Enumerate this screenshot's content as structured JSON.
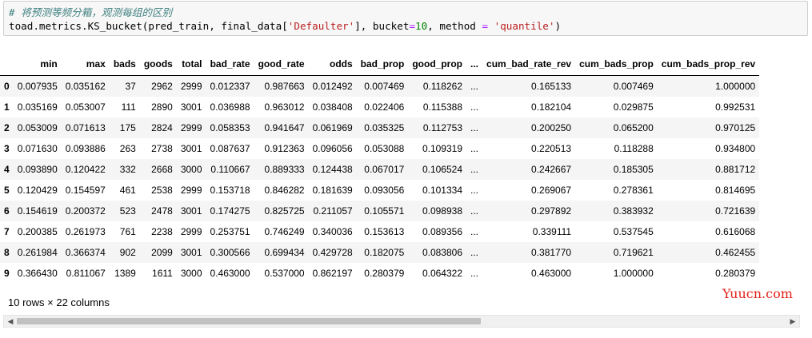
{
  "input": {
    "comment": "# 将预测等频分箱，观测每组的区别",
    "code_prefix": "toad.metrics.KS_bucket(pred_train, final_data[",
    "code_str1": "'Defaulter'",
    "code_mid": "], bucket",
    "code_eq1": "=",
    "code_num": "10",
    "code_mid2": ", method ",
    "code_eq2": "=",
    "code_str2": " 'quantile'",
    "code_suffix": ")"
  },
  "table": {
    "columns": [
      "",
      "min",
      "max",
      "bads",
      "goods",
      "total",
      "bad_rate",
      "good_rate",
      "odds",
      "bad_prop",
      "good_prop",
      "...",
      "cum_bad_rate_rev",
      "cum_bads_prop",
      "cum_bads_prop_rev"
    ],
    "rows": [
      [
        "0",
        "0.007935",
        "0.035162",
        "37",
        "2962",
        "2999",
        "0.012337",
        "0.987663",
        "0.012492",
        "0.007469",
        "0.118262",
        "...",
        "0.165133",
        "0.007469",
        "1.000000"
      ],
      [
        "1",
        "0.035169",
        "0.053007",
        "111",
        "2890",
        "3001",
        "0.036988",
        "0.963012",
        "0.038408",
        "0.022406",
        "0.115388",
        "...",
        "0.182104",
        "0.029875",
        "0.992531"
      ],
      [
        "2",
        "0.053009",
        "0.071613",
        "175",
        "2824",
        "2999",
        "0.058353",
        "0.941647",
        "0.061969",
        "0.035325",
        "0.112753",
        "...",
        "0.200250",
        "0.065200",
        "0.970125"
      ],
      [
        "3",
        "0.071630",
        "0.093886",
        "263",
        "2738",
        "3001",
        "0.087637",
        "0.912363",
        "0.096056",
        "0.053088",
        "0.109319",
        "...",
        "0.220513",
        "0.118288",
        "0.934800"
      ],
      [
        "4",
        "0.093890",
        "0.120422",
        "332",
        "2668",
        "3000",
        "0.110667",
        "0.889333",
        "0.124438",
        "0.067017",
        "0.106524",
        "...",
        "0.242667",
        "0.185305",
        "0.881712"
      ],
      [
        "5",
        "0.120429",
        "0.154597",
        "461",
        "2538",
        "2999",
        "0.153718",
        "0.846282",
        "0.181639",
        "0.093056",
        "0.101334",
        "...",
        "0.269067",
        "0.278361",
        "0.814695"
      ],
      [
        "6",
        "0.154619",
        "0.200372",
        "523",
        "2478",
        "3001",
        "0.174275",
        "0.825725",
        "0.211057",
        "0.105571",
        "0.098938",
        "...",
        "0.297892",
        "0.383932",
        "0.721639"
      ],
      [
        "7",
        "0.200385",
        "0.261973",
        "761",
        "2238",
        "2999",
        "0.253751",
        "0.746249",
        "0.340036",
        "0.153613",
        "0.089356",
        "...",
        "0.339111",
        "0.537545",
        "0.616068"
      ],
      [
        "8",
        "0.261984",
        "0.366374",
        "902",
        "2099",
        "3001",
        "0.300566",
        "0.699434",
        "0.429728",
        "0.182075",
        "0.083806",
        "...",
        "0.381770",
        "0.719621",
        "0.462455"
      ],
      [
        "9",
        "0.366430",
        "0.811067",
        "1389",
        "1611",
        "3000",
        "0.463000",
        "0.537000",
        "0.862197",
        "0.280379",
        "0.064322",
        "...",
        "0.463000",
        "1.000000",
        "0.280379"
      ]
    ]
  },
  "footer": "10 rows × 22 columns",
  "watermark": "Yuucn.com",
  "scroll": {
    "left_arrow": "◀",
    "right_arrow": "▶"
  }
}
